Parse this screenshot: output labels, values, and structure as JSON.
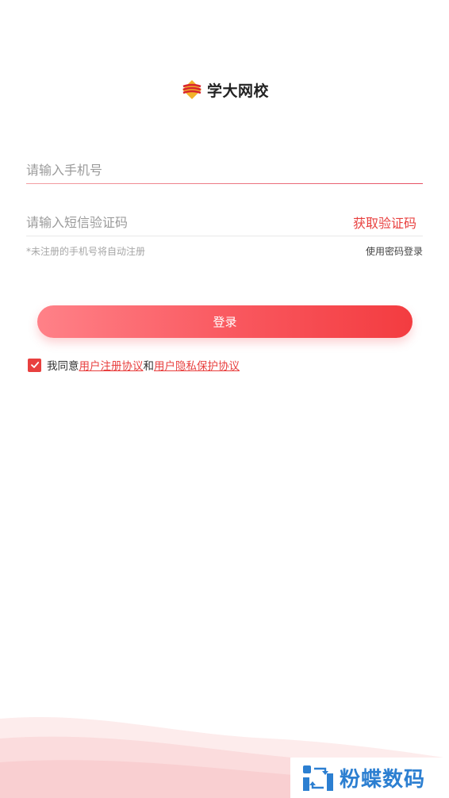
{
  "brand": {
    "name": "学大网校",
    "accent_color": "#e8403f"
  },
  "form": {
    "phone_placeholder": "请输入手机号",
    "phone_value": "",
    "code_placeholder": "请输入短信验证码",
    "code_value": "",
    "get_code_label": "获取验证码",
    "tip": "*未注册的手机号将自动注册",
    "password_login_label": "使用密码登录",
    "login_button_label": "登录"
  },
  "agreement": {
    "checked": true,
    "prefix": "我同意",
    "user_agreement": "用户注册协议",
    "connector": "和",
    "privacy_policy": "用户隐私保护协议"
  },
  "watermark": {
    "text": "粉蝶数码"
  }
}
